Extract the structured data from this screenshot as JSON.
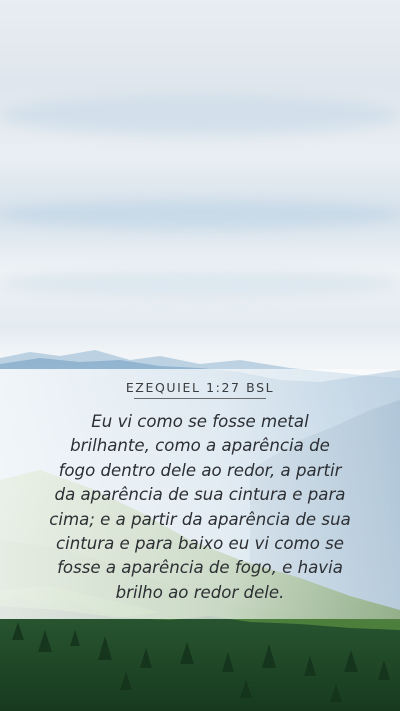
{
  "verse": {
    "reference": "EZEQUIEL 1:27 BSL",
    "lines": [
      "Eu vi como se fosse metal",
      "brilhante, como a aparência de",
      "fogo dentro dele ao redor, a partir",
      "da aparência de sua cintura e para",
      "cima; e a partir da aparência de sua",
      "cintura e para baixo eu vi como se",
      "fosse a aparência de fogo, e havia",
      "brilho ao redor dele."
    ]
  },
  "colors": {
    "sky": "#e8edf2",
    "mountain_blue": "#8fb3cf",
    "forest_green": "#2f5a2c",
    "text": "#2c2f33"
  }
}
